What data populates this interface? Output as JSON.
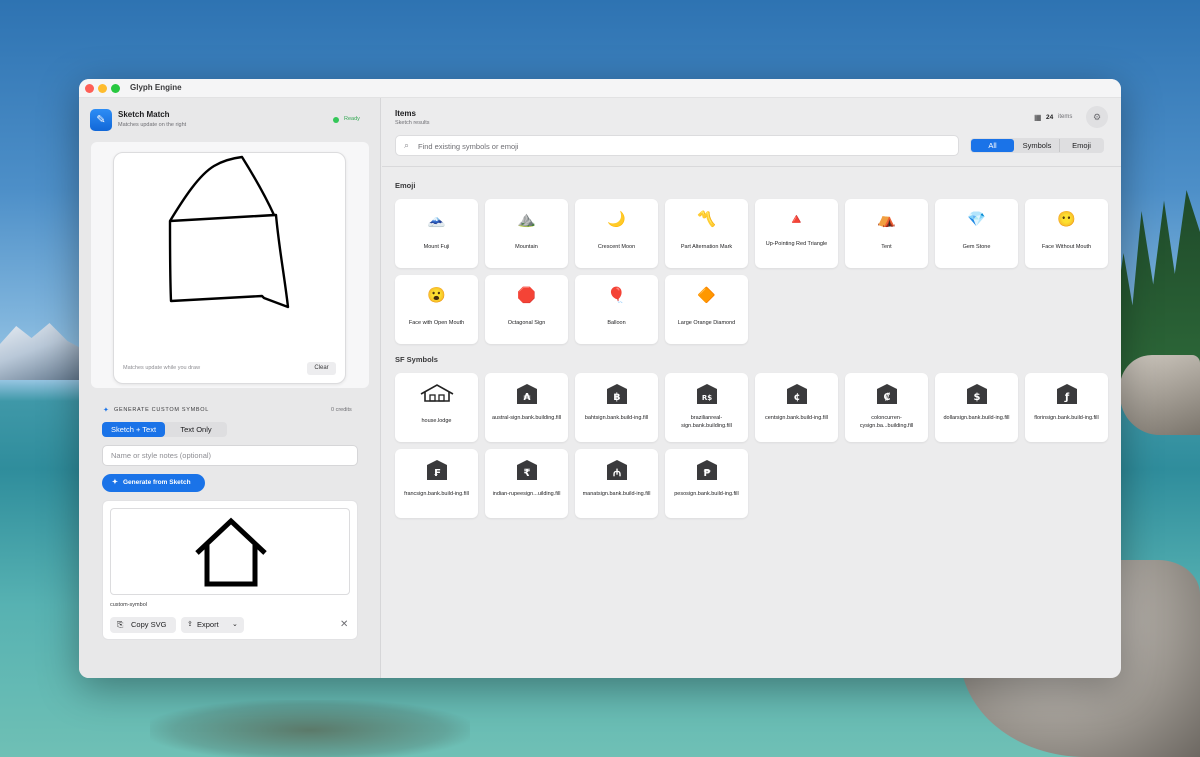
{
  "window": {
    "title": "Glyph Engine"
  },
  "sidebar": {
    "app_name": "Sketch Match",
    "app_subtitle": "Matches update on the right",
    "status": "Ready",
    "canvas_hint": "Matches update while you draw",
    "clear_label": "Clear",
    "generate_header": "GENERATE CUSTOM SYMBOL",
    "credits": "0 credits",
    "mode_tabs": [
      "Sketch + Text",
      "Text Only"
    ],
    "notes_placeholder": "Name or style notes (optional)",
    "generate_button": "Generate from Sketch",
    "result": {
      "name": "custom-symbol",
      "copy_label": "Copy SVG",
      "export_label": "Export"
    }
  },
  "main": {
    "title": "Items",
    "subtitle": "Sketch results",
    "count": "24",
    "count_label": "items",
    "search_placeholder": "Find existing symbols or emoji",
    "filters": [
      "All",
      "Symbols",
      "Emoji"
    ],
    "emoji_section": "Emoji",
    "symbols_section": "SF Symbols",
    "emoji": [
      {
        "glyph": "🗻",
        "label": "Mount Fuji"
      },
      {
        "glyph": "⛰️",
        "label": "Mountain"
      },
      {
        "glyph": "🌙",
        "label": "Crescent Moon"
      },
      {
        "glyph": "〽️",
        "label": "Part Alternation Mark"
      },
      {
        "glyph": "🔺",
        "label": "Up-Pointing Red Triangle"
      },
      {
        "glyph": "⛺",
        "label": "Tent"
      },
      {
        "glyph": "💎",
        "label": "Gem Stone"
      },
      {
        "glyph": "😶",
        "label": "Face Without Mouth"
      },
      {
        "glyph": "😮",
        "label": "Face with Open Mouth"
      },
      {
        "glyph": "🛑",
        "label": "Octagonal Sign"
      },
      {
        "glyph": "🎈",
        "label": "Balloon"
      },
      {
        "glyph": "🔶",
        "label": "Large Orange Diamond"
      }
    ],
    "symbols": [
      {
        "glyph": "",
        "label": "house.lodge",
        "icon": "house-lodge-icon"
      },
      {
        "glyph": "₳",
        "label": "austral-sign.bank.building.fill",
        "icon": "bank-icon"
      },
      {
        "glyph": "฿",
        "label": "bahtsign.bank.build-ing.fill",
        "icon": "bank-icon"
      },
      {
        "glyph": "R$",
        "label": "brazilianreal-sign.bank.building.fill",
        "icon": "bank-icon"
      },
      {
        "glyph": "¢",
        "label": "centsign.bank.build-ing.fill",
        "icon": "bank-icon"
      },
      {
        "glyph": "₡",
        "label": "coloncurren-cysign.ba...building.fill",
        "icon": "bank-icon"
      },
      {
        "glyph": "$",
        "label": "dollarsign.bank.build-ing.fill",
        "icon": "bank-icon"
      },
      {
        "glyph": "ƒ",
        "label": "florinsign.bank.build-ing.fill",
        "icon": "bank-icon"
      },
      {
        "glyph": "₣",
        "label": "francsign.bank.build-ing.fill",
        "icon": "bank-icon"
      },
      {
        "glyph": "₹",
        "label": "indian-rupeesign...uilding.fill",
        "icon": "bank-icon"
      },
      {
        "glyph": "₼",
        "label": "manatsign.bank.build-ing.fill",
        "icon": "bank-icon"
      },
      {
        "glyph": "₱",
        "label": "pesosign.bank.build-ing.fill",
        "icon": "bank-icon"
      }
    ]
  },
  "colors": {
    "accent": "#1a73e8",
    "ready": "#34c759"
  }
}
